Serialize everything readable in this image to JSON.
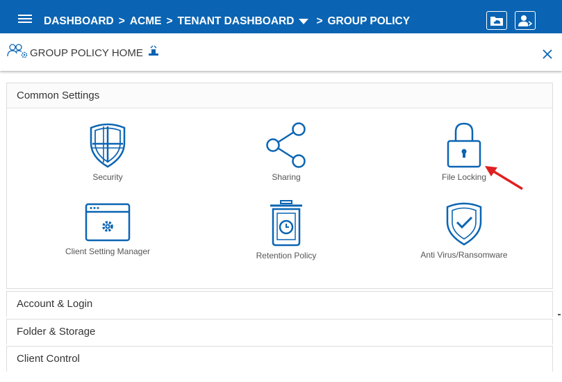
{
  "topbar": {
    "breadcrumbs": [
      "DASHBOARD",
      "ACME",
      "TENANT DASHBOARD",
      "GROUP POLICY"
    ],
    "separator": ">",
    "bg_color": "#0a64b3"
  },
  "subheader": {
    "title": "GROUP POLICY HOME"
  },
  "sections": {
    "common": {
      "title": "Common Settings",
      "tiles": [
        {
          "label": "Security",
          "icon": "shield-icon"
        },
        {
          "label": "Sharing",
          "icon": "share-icon"
        },
        {
          "label": "File Locking",
          "icon": "lock-icon"
        },
        {
          "label": "Client Setting Manager",
          "icon": "settings-window-icon"
        },
        {
          "label": "Retention Policy",
          "icon": "trash-clock-icon"
        },
        {
          "label": "Anti Virus/Ransomware",
          "icon": "shield-check-icon"
        }
      ]
    },
    "account": {
      "title": "Account & Login"
    },
    "folder": {
      "title": "Folder & Storage"
    },
    "client": {
      "title": "Client Control"
    }
  },
  "colors": {
    "icon_blue": "#0a64b3",
    "annotation_red": "#e02020"
  }
}
